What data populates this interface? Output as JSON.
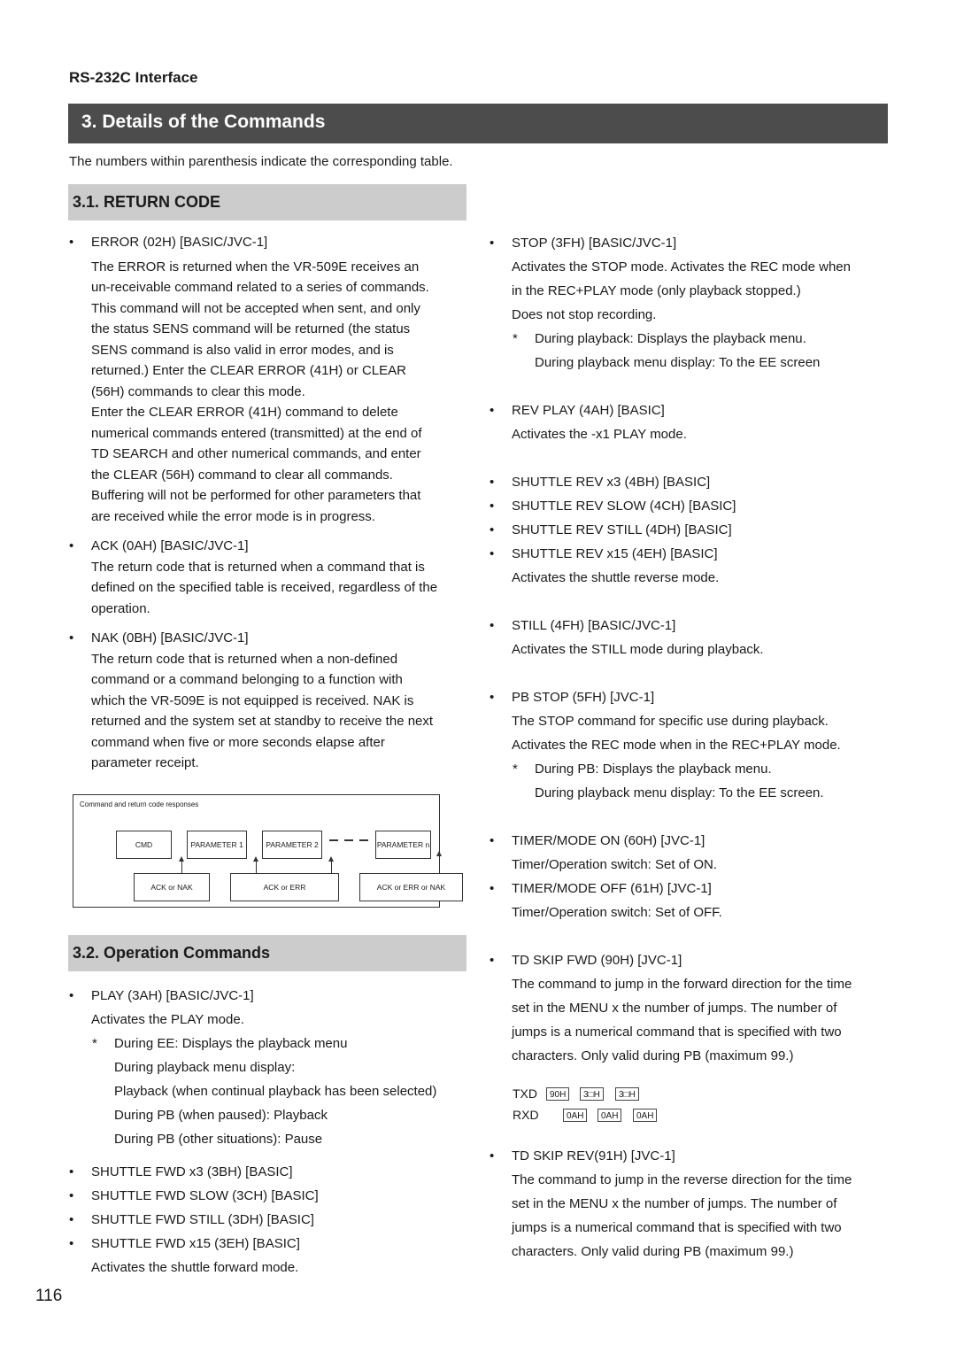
{
  "running_head": "RS-232C Interface",
  "chapter_title": "3. Details of the Commands",
  "intro": "The numbers within parenthesis indicate the corresponding table.",
  "section_31": {
    "title": "3.1. RETURN CODE",
    "items": [
      {
        "title": "ERROR (02H) [BASIC/JVC-1]",
        "lines": [
          "The ERROR is returned when the VR-509E receives an",
          "un-receivable command related to a series of commands.",
          "This command will not be accepted when sent, and only",
          "the status SENS command will be returned (the status",
          "SENS command is also valid in error modes, and is",
          "returned.) Enter the CLEAR ERROR (41H) or CLEAR",
          "(56H) commands to clear this mode.",
          "Enter the CLEAR ERROR (41H) command to delete",
          "numerical commands entered (transmitted) at the end of",
          "TD SEARCH and other numerical commands, and enter",
          "the CLEAR (56H) command to clear all commands.",
          "Buffering will not be performed for other parameters that",
          "are received while the error mode is in progress."
        ]
      },
      {
        "title": "ACK (0AH) [BASIC/JVC-1]",
        "lines": [
          "The return code that is returned when a command that is",
          "defined on the specified table is received, regardless of the",
          "operation."
        ]
      },
      {
        "title": "NAK (0BH) [BASIC/JVC-1]",
        "lines": [
          "The return code that is returned when a non-defined",
          "command or a command belonging to a function with",
          "which the VR-509E is not equipped is received. NAK is",
          "returned and the system set at standby to receive the next",
          "command when five or more seconds elapse after",
          "parameter receipt."
        ]
      }
    ],
    "diagram": {
      "caption": "Command and return code responses",
      "commands": [
        "CMD",
        "PARAMETER 1",
        "PARAMETER 2",
        "PARAMETER n"
      ],
      "responses": [
        "ACK or NAK",
        "ACK or ERR",
        "ACK or ERR or NAK"
      ]
    }
  },
  "section_32": {
    "title": "3.2. Operation Commands",
    "play": {
      "title": "PLAY (3AH) [BASIC/JVC-1]",
      "desc": "Activates the PLAY mode.",
      "note_star": "*",
      "notes": [
        "During EE: Displays the playback menu",
        "During playback menu display:",
        "Playback (when continual playback has been selected)",
        "During PB (when paused): Playback",
        "During PB (other situations): Pause"
      ]
    },
    "shuttle_fwd": {
      "titles": [
        "SHUTTLE FWD x3 (3BH) [BASIC]",
        "SHUTTLE FWD SLOW (3CH) [BASIC]",
        "SHUTTLE FWD STILL (3DH) [BASIC]",
        "SHUTTLE FWD x15 (3EH) [BASIC]"
      ],
      "desc": "Activates the shuttle forward mode."
    }
  },
  "right_column": {
    "stop": {
      "title": "STOP (3FH) [BASIC/JVC-1]",
      "lines": [
        "Activates the STOP mode. Activates the REC mode when",
        "in the REC+PLAY mode (only playback stopped.)",
        "Does not stop recording."
      ],
      "notes": [
        "During playback: Displays the playback menu.",
        "During playback menu display: To the EE screen"
      ]
    },
    "rev_play": {
      "title": "REV PLAY (4AH) [BASIC]",
      "desc": "Activates the -x1 PLAY mode."
    },
    "shuttle_rev": {
      "titles": [
        "SHUTTLE REV x3 (4BH) [BASIC]",
        "SHUTTLE REV SLOW (4CH) [BASIC]",
        "SHUTTLE REV STILL (4DH) [BASIC]",
        "SHUTTLE REV x15 (4EH) [BASIC]"
      ],
      "desc": "Activates the shuttle reverse mode."
    },
    "still": {
      "title": "STILL (4FH) [BASIC/JVC-1]",
      "desc": "Activates the STILL mode during playback."
    },
    "pb_stop": {
      "title": "PB STOP (5FH) [JVC-1]",
      "lines": [
        "The STOP command for specific use during playback.",
        "Activates the REC mode when in the REC+PLAY mode."
      ],
      "notes": [
        "During PB: Displays the playback menu.",
        "During playback menu display: To the EE screen."
      ]
    },
    "timer_on": {
      "title": "TIMER/MODE ON (60H) [JVC-1]",
      "desc": "Timer/Operation switch: Set of ON."
    },
    "timer_off": {
      "title": "TIMER/MODE OFF (61H) [JVC-1]",
      "desc": "Timer/Operation switch: Set of OFF."
    },
    "td_skip_fwd": {
      "title": "TD SKIP FWD (90H) [JVC-1]",
      "lines": [
        "The command to jump in the forward direction for the time",
        "set in the MENU x the number of jumps. The number of",
        "jumps is a numerical command that is specified with two",
        "characters. Only valid during PB (maximum 99.)"
      ],
      "sequence": {
        "txd_label": "TXD",
        "rxd_label": "RXD",
        "txd": [
          "90H",
          "3□H",
          "3□H"
        ],
        "rxd": [
          "0AH",
          "0AH",
          "0AH"
        ]
      }
    },
    "td_skip_rev": {
      "title": "TD SKIP REV(91H) [JVC-1]",
      "lines": [
        "The command to jump in the reverse direction for the time",
        "set in the MENU x the number of jumps. The number of",
        "jumps is a numerical command that is specified with two",
        "characters. Only valid during PB (maximum 99.)"
      ]
    }
  },
  "bullet_glyph": "•",
  "page_number": "116",
  "colors": {
    "chapter_bar": "#4c4c4c",
    "section_bar": "#cccccc",
    "text": "#1a1a1a"
  }
}
